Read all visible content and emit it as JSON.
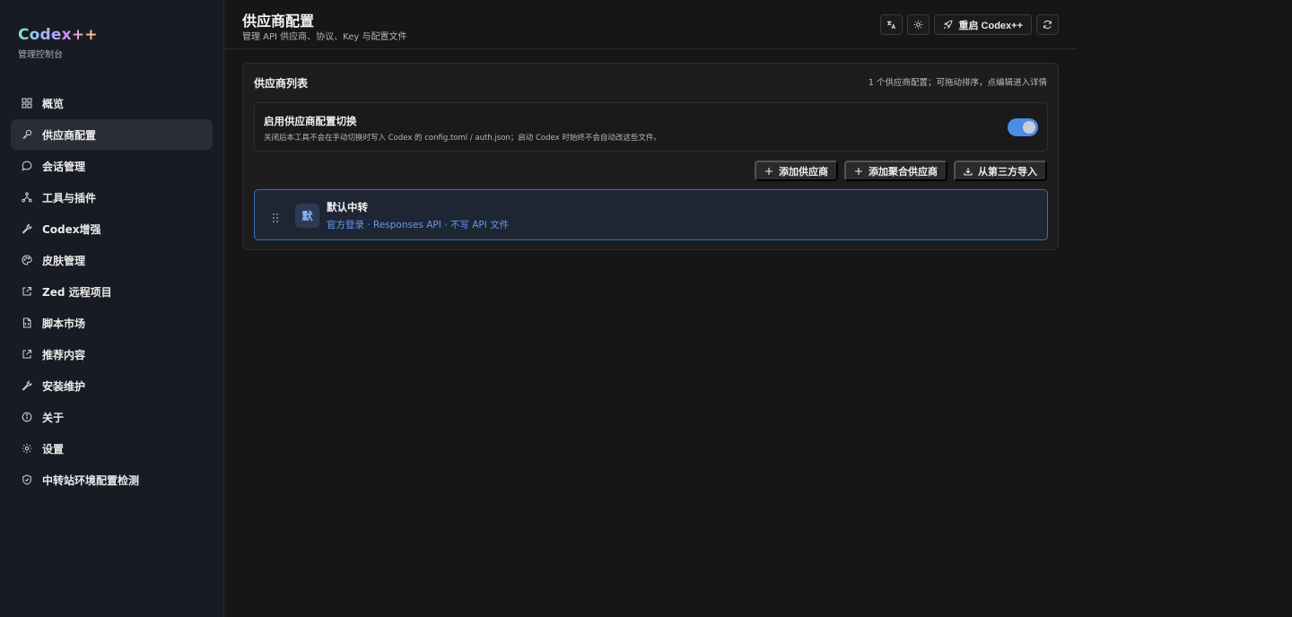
{
  "brand": {
    "title": "Codex++",
    "subtitle": "管理控制台"
  },
  "sidebar": {
    "items": [
      {
        "label": "概览",
        "icon": "grid-icon"
      },
      {
        "label": "供应商配置",
        "icon": "key-icon",
        "active": true
      },
      {
        "label": "会话管理",
        "icon": "chat-icon"
      },
      {
        "label": "工具与插件",
        "icon": "nodes-icon"
      },
      {
        "label": "Codex增强",
        "icon": "wrench-icon"
      },
      {
        "label": "皮肤管理",
        "icon": "palette-icon"
      },
      {
        "label": "Zed 远程项目",
        "icon": "external-link-icon"
      },
      {
        "label": "脚本市场",
        "icon": "file-code-icon"
      },
      {
        "label": "推荐内容",
        "icon": "external-link-icon"
      },
      {
        "label": "安装维护",
        "icon": "wrench-icon"
      },
      {
        "label": "关于",
        "icon": "info-icon"
      },
      {
        "label": "设置",
        "icon": "gear-icon"
      },
      {
        "label": "中转站环境配置检测",
        "icon": "shield-icon"
      }
    ]
  },
  "header": {
    "title": "供应商配置",
    "subtitle": "管理 API 供应商、协议、Key 与配置文件",
    "restart_label": "重启 Codex++"
  },
  "card": {
    "title": "供应商列表",
    "hint": "1 个供应商配置；可拖动排序，点编辑进入详情",
    "switch": {
      "title": "启用供应商配置切换",
      "desc": "关闭后本工具不会在手动切换时写入 Codex 的 config.toml / auth.json；启动 Codex 时始终不会自动改这些文件。",
      "enabled": true
    },
    "actions": {
      "add": "添加供应商",
      "add_aggregate": "添加聚合供应商",
      "import": "从第三方导入"
    },
    "provider": {
      "avatar": "默",
      "name": "默认中转",
      "meta": "官方登录 · Responses API · 不写 API 文件"
    }
  },
  "colors": {
    "accent": "#4c8de6",
    "link": "#5d9bf0",
    "sidebar_bg": "#181b23",
    "main_bg": "#161616"
  }
}
